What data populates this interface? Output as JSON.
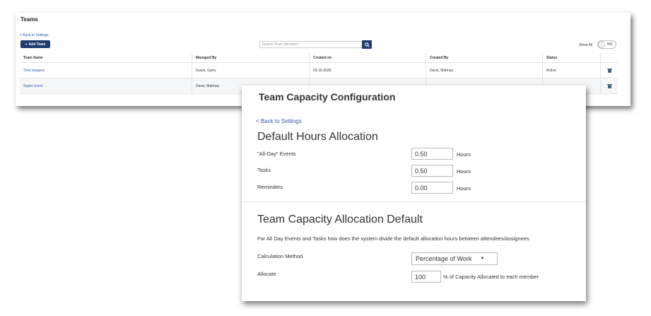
{
  "teams": {
    "title": "Teams",
    "back_label": "< Back to Settings",
    "add_team_label": "Add Team",
    "search_placeholder": "Search Team Members",
    "show_all_label": "Show All",
    "toggle_state": "NO",
    "columns": [
      "Team Name",
      "Managed By",
      "Created on",
      "Created By",
      "Status"
    ],
    "rows": [
      {
        "team": "Time keepers",
        "managed_by": "Guest, Garry",
        "created_on": "03-16-2026",
        "created_by": "Davis, Mahnaz",
        "status": "Active"
      },
      {
        "team": "Super Users",
        "managed_by": "Davis, Mahnaz",
        "created_on": "",
        "created_by": "",
        "status": ""
      }
    ]
  },
  "capacity": {
    "title": "Team Capacity Configuration",
    "back_label": "< Back to Settings",
    "default_hours": {
      "heading": "Default Hours Allocation",
      "fields": [
        {
          "label": "\"All-Day\" Events",
          "value": "0.50",
          "unit": "Hours"
        },
        {
          "label": "Tasks",
          "value": "0.50",
          "unit": "Hours"
        },
        {
          "label": "Reminders",
          "value": "0.00",
          "unit": "Hours"
        }
      ]
    },
    "allocation_default": {
      "heading": "Team Capacity Allocation Default",
      "description": "For All Day Events and Tasks how does the system divide the default allocation hours between attendees/assignees",
      "method_label": "Calculation Method",
      "method_value": "Percentage of Work",
      "allocate_label": "Allocate",
      "allocate_value": "100",
      "allocate_suffix": "% of Capacity Allocated to each member"
    }
  },
  "colors": {
    "primary_button": "#1f3a6b",
    "link": "#2f5aa8"
  }
}
